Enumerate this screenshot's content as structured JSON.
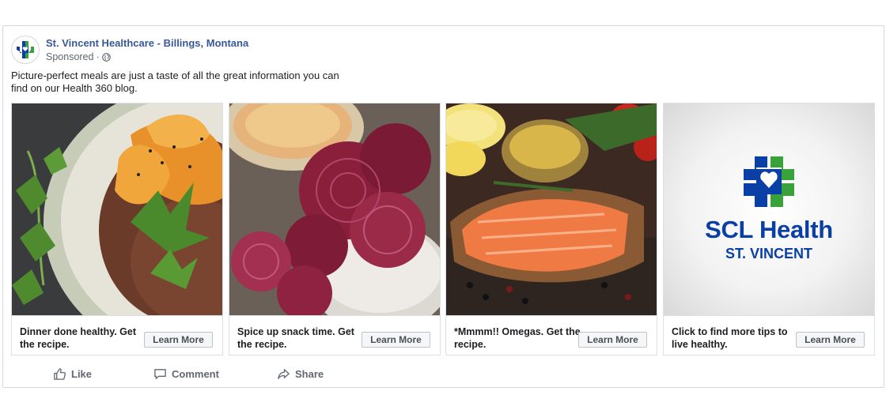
{
  "header": {
    "page_name": "St. Vincent Healthcare - Billings, Montana",
    "sponsored": "Sponsored",
    "separator": "·",
    "icons": {
      "avatar": "scl-cross-logo",
      "audience": "globe-icon"
    }
  },
  "post": {
    "text": "Picture-perfect meals are just a taste of all the great information you can find on our Health 360 blog."
  },
  "carousel": {
    "cards": [
      {
        "image": "grain-bowl-photo",
        "caption": "Dinner done healthy. Get the recipe.",
        "button": "Learn More"
      },
      {
        "image": "beet-chips-photo",
        "caption": "Spice up snack time. Get the recipe.",
        "button": "Learn More"
      },
      {
        "image": "salmon-fillet-photo",
        "caption": "*Mmmm!! Omegas. Get the recipe.",
        "button": "Learn More"
      },
      {
        "image": "scl-health-logo",
        "caption": "Click to find more tips to live healthy.",
        "button": "Learn More"
      }
    ],
    "logo": {
      "brand": "SCL Health",
      "sub": "ST. VINCENT"
    }
  },
  "actions": {
    "like": "Like",
    "comment": "Comment",
    "share": "Share"
  },
  "colors": {
    "link": "#385898",
    "scl_blue": "#0a3fa6",
    "scl_green": "#3aa23a"
  }
}
